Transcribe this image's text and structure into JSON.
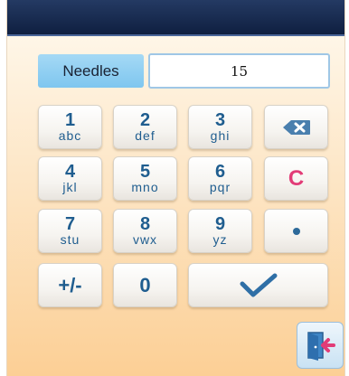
{
  "field": {
    "label": "Needles",
    "value": "15"
  },
  "keys": {
    "k1": {
      "num": "1",
      "letters": "abc"
    },
    "k2": {
      "num": "2",
      "letters": "def"
    },
    "k3": {
      "num": "3",
      "letters": "ghi"
    },
    "k4": {
      "num": "4",
      "letters": "jkl"
    },
    "k5": {
      "num": "5",
      "letters": "mno"
    },
    "k6": {
      "num": "6",
      "letters": "pqr"
    },
    "k7": {
      "num": "7",
      "letters": "stu"
    },
    "k8": {
      "num": "8",
      "letters": "vwx"
    },
    "k9": {
      "num": "9",
      "letters": "yz"
    },
    "k0": {
      "num": "0"
    },
    "clear": "C",
    "sign": "+/-"
  },
  "icons": {
    "backspace": "backspace-icon",
    "decimal": "decimal-point-icon",
    "confirm": "checkmark-icon",
    "exit": "exit-door-icon"
  },
  "colors": {
    "title_bar": "#1b2f55",
    "accent_blue": "#1f5d8f",
    "clear_pink": "#e23c77",
    "label_bg": "#8fcdf2"
  }
}
